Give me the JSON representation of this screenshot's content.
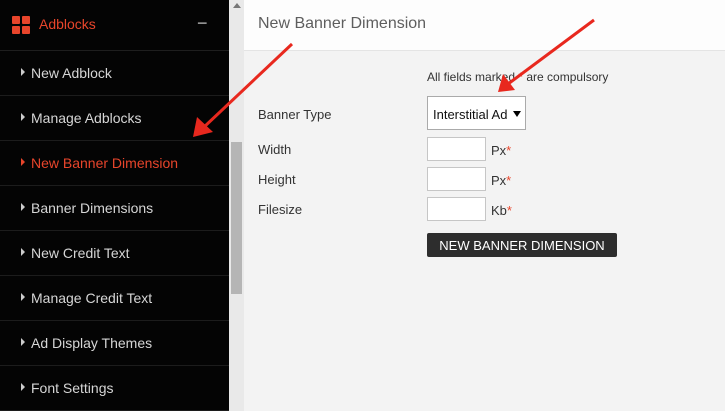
{
  "sidebar": {
    "header_title": "Adblocks",
    "collapse_symbol": "−",
    "items": [
      {
        "label": "New Adblock"
      },
      {
        "label": "Manage Adblocks"
      },
      {
        "label": "New Banner Dimension"
      },
      {
        "label": "Banner Dimensions"
      },
      {
        "label": "New Credit Text"
      },
      {
        "label": "Manage Credit Text"
      },
      {
        "label": "Ad Display Themes"
      },
      {
        "label": "Font Settings"
      }
    ],
    "active_index": 2
  },
  "main": {
    "title": "New Banner Dimension",
    "hint_before": "All fields marked ",
    "hint_star": "*",
    "hint_after": " are compulsory",
    "fields": {
      "banner_type": {
        "label": "Banner Type",
        "value": "Interstitial Ad"
      },
      "width": {
        "label": "Width",
        "unit": "Px",
        "value": ""
      },
      "height": {
        "label": "Height",
        "unit": "Px",
        "value": ""
      },
      "filesize": {
        "label": "Filesize",
        "unit": "Kb",
        "value": ""
      }
    },
    "required_mark": "*",
    "submit_label": "NEW BANNER DIMENSION"
  },
  "colors": {
    "accent": "#e8452b",
    "sidebar_bg": "#040404",
    "annotation_arrow": "#e8281e",
    "button_bg": "#2d2d2d"
  },
  "icons": {
    "header": "grid-icon",
    "items": "caret-right-icon",
    "scroll": "scroll-up-icon"
  }
}
